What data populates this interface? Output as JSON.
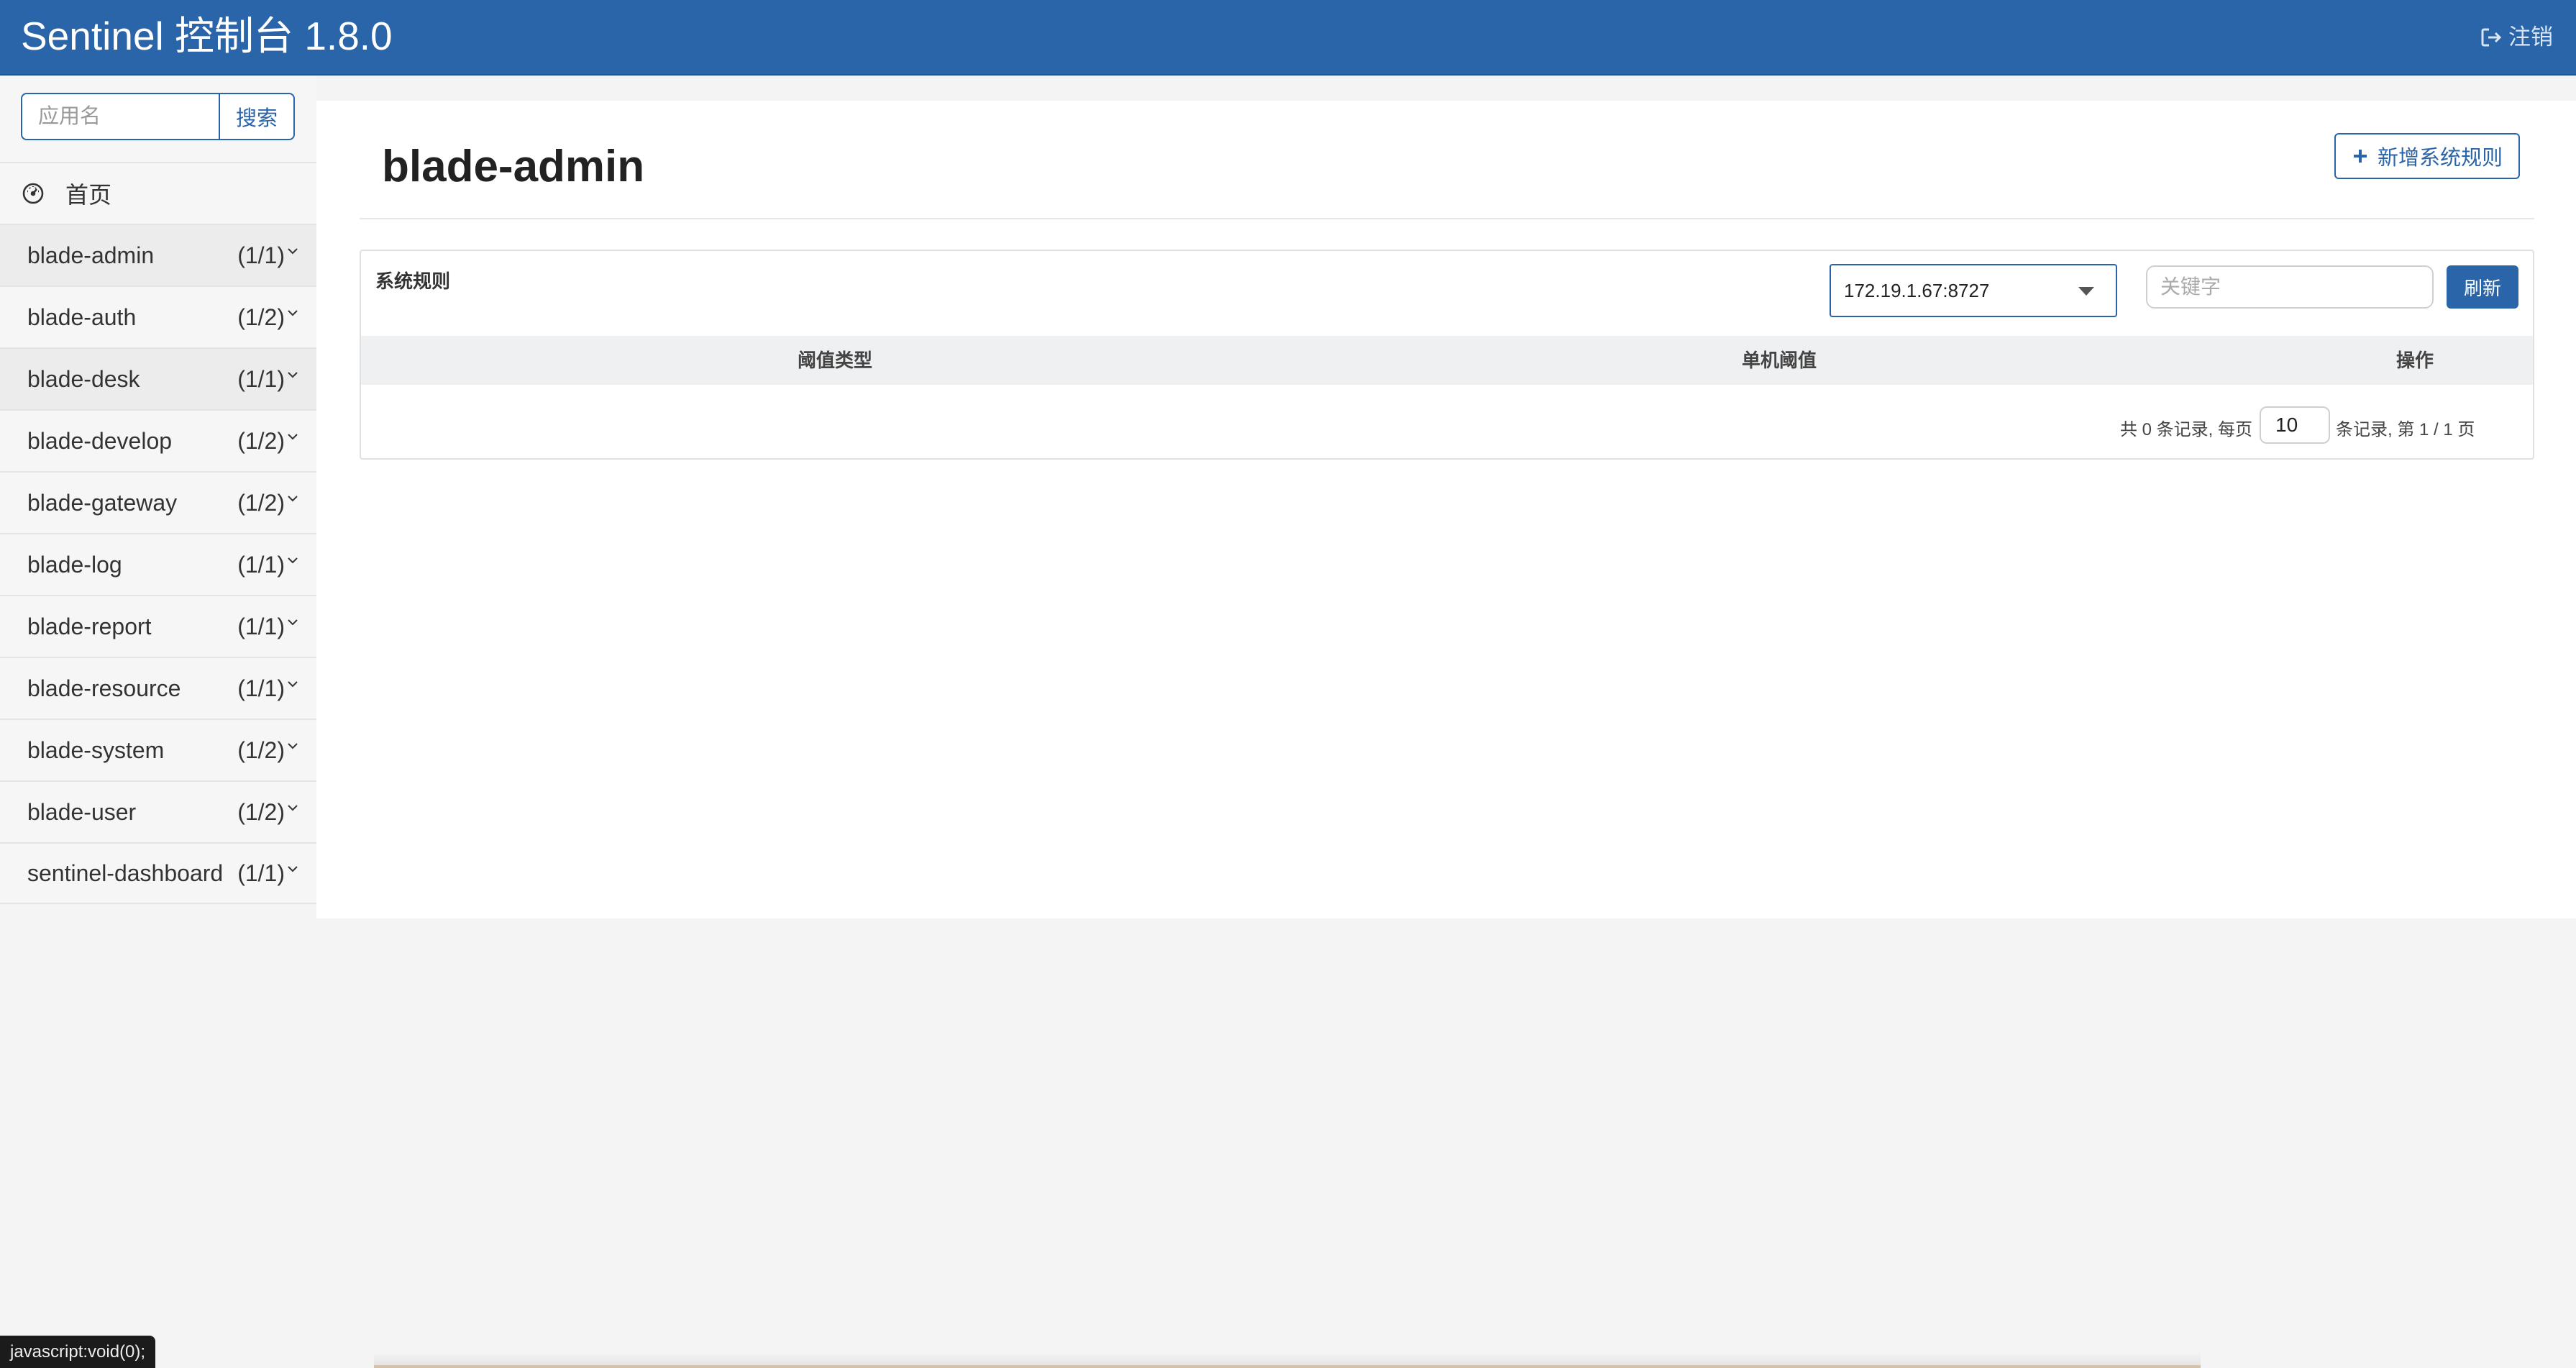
{
  "header": {
    "brand": "Sentinel 控制台 1.8.0",
    "logout_label": "注销",
    "logout_icon": "sign-out-icon",
    "bg_color": "#2a64a9"
  },
  "sidebar": {
    "search_placeholder": "应用名",
    "search_button": "搜索",
    "home_label": "首页",
    "home_icon": "dashboard-icon",
    "apps": [
      {
        "name": "blade-admin",
        "count": "(1/1)"
      },
      {
        "name": "blade-auth",
        "count": "(1/2)"
      },
      {
        "name": "blade-desk",
        "count": "(1/1)"
      },
      {
        "name": "blade-develop",
        "count": "(1/2)"
      },
      {
        "name": "blade-gateway",
        "count": "(1/2)"
      },
      {
        "name": "blade-log",
        "count": "(1/1)"
      },
      {
        "name": "blade-report",
        "count": "(1/1)"
      },
      {
        "name": "blade-resource",
        "count": "(1/1)"
      },
      {
        "name": "blade-system",
        "count": "(1/2)"
      },
      {
        "name": "blade-user",
        "count": "(1/2)"
      },
      {
        "name": "sentinel-dashboard",
        "count": "(1/1)"
      }
    ]
  },
  "main": {
    "title": "blade-admin",
    "add_button": "新增系统规则",
    "panel": {
      "title": "系统规则",
      "machine_selected": "172.19.1.67:8727",
      "keyword_placeholder": "关键字",
      "refresh_button": "刷新",
      "columns": [
        "阈值类型",
        "单机阈值",
        "操作"
      ],
      "rows": [],
      "pager": {
        "prefix": "共 0 条记录, 每页",
        "page_size": "10",
        "suffix": "条记录, 第 1 / 1 页"
      }
    }
  },
  "status_bar": {
    "text": "javascript:void(0);"
  }
}
